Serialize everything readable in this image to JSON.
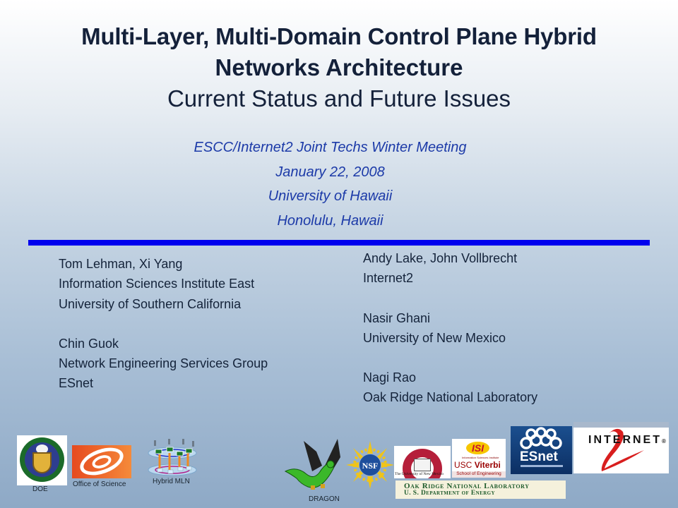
{
  "slide": {
    "title_line1": "Multi-Layer, Multi-Domain Control Plane Hybrid",
    "title_line2": "Networks Architecture",
    "subtitle": "Current Status and Future Issues",
    "meeting": {
      "event": "ESCC/Internet2 Joint Techs Winter Meeting",
      "date": "January 22, 2008",
      "venue": "University of Hawaii",
      "location": "Honolulu,  Hawaii"
    },
    "colors": {
      "title": "#14213a",
      "meeting_text": "#1c3aa8",
      "divider": "#0000ee"
    }
  },
  "authors_left": [
    {
      "names": "Tom Lehman, Xi Yang",
      "affiliation_lines": [
        "Information Sciences Institute East",
        "University of Southern California"
      ]
    },
    {
      "names": "Chin Guok",
      "affiliation_lines": [
        "Network Engineering Services Group",
        "ESnet"
      ]
    }
  ],
  "authors_right": [
    {
      "names": "Andy Lake, John Vollbrecht",
      "affiliation_lines": [
        "Internet2"
      ]
    },
    {
      "names": "Nasir Ghani",
      "affiliation_lines": [
        "University of New Mexico"
      ]
    },
    {
      "names": "Nagi Rao",
      "affiliation_lines": [
        "Oak Ridge National Laboratory"
      ]
    }
  ],
  "logos": {
    "doe": {
      "label": "DOE"
    },
    "office_of_science": {
      "label": "Office of Science"
    },
    "hybrid_mln": {
      "label": "Hybrid MLN"
    },
    "dragon": {
      "label": "DRAGON"
    },
    "nsf": {
      "text": "NSF"
    },
    "unm": {
      "text": "The University of New Mexico"
    },
    "isi": {
      "mark": "ISI",
      "sub": "Information Sciences Institute",
      "usc": "USC",
      "viterbi": "Viterbi",
      "school": "School of Engineering"
    },
    "ornl": {
      "line1": "Oak Ridge National Laboratory",
      "line2": "U. S. Department of Energy"
    },
    "esnet": {
      "text": "ESnet"
    },
    "internet2": {
      "text": "INTERNET",
      "reg": "®"
    }
  }
}
